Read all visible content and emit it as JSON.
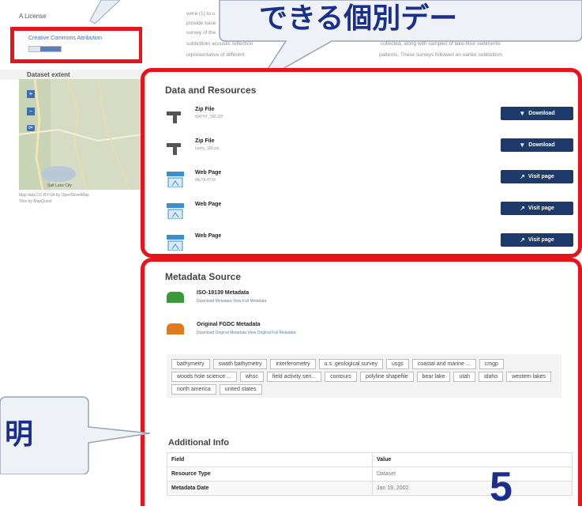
{
  "sidebar": {
    "license_heading": "A License",
    "license_link": "Creative Commons Attribution",
    "extent_heading": "Dataset extent",
    "map_credit_line1": "Map data CC-BY-SA by OpenStreetMap",
    "map_credit_line2": "Tiles by MapQuest",
    "map_label": "Salt Lake City",
    "shield_label": "84"
  },
  "description": {
    "line1": "were (1) to u",
    "line2": "provide base",
    "line3": "survey of the ",
    "line4a": "subbottom acoustic reflection",
    "line4b": "collected, along with samples of lake-floor sediments",
    "line5a": "representative of different",
    "line5b": "patterns. These surveys followed an earlier subbottom"
  },
  "callouts": {
    "top_text": "できる個別デー",
    "left_text": "明",
    "page_number": "5"
  },
  "resources": {
    "title": "Data and Resources",
    "items": [
      {
        "name": "Zip File",
        "sub": "BATHY_SM.ZIP",
        "button": "Download",
        "icon": "download-icon"
      },
      {
        "name": "Zip File",
        "sub": "bathy_SM.zip",
        "button": "Download",
        "icon": "download-icon"
      },
      {
        "name": "Web Page",
        "sub": "META.HTM",
        "button": "Visit page",
        "icon": "external-link-icon"
      },
      {
        "name": "Web Page",
        "sub": "",
        "button": "Visit page",
        "icon": "external-link-icon"
      },
      {
        "name": "Web Page",
        "sub": "",
        "button": "Visit page",
        "icon": "external-link-icon"
      }
    ]
  },
  "metadata": {
    "title": "Metadata Source",
    "items": [
      {
        "name": "ISO-19139 Metadata",
        "links": "Download Metadata   View Full Metadata",
        "color": "#3a9a3a"
      },
      {
        "name": "Original FGDC Metadata",
        "links": "Download Original Metadata   View Original Full Metadata",
        "color": "#e07a1e"
      }
    ]
  },
  "tags": [
    "bathymetry",
    "swath bathymetry",
    "interferometry",
    "u.s. geological survey",
    "usgs",
    "coastal and marine ...",
    "cmgp",
    "woods hole science ...",
    "whsc",
    "field activity seri...",
    "contours",
    "polyline shapefile",
    "bear lake",
    "utah",
    "idaho",
    "western lakes",
    "north america",
    "united states"
  ],
  "additional_info": {
    "title": "Additional Info",
    "header": [
      "Field",
      "Value"
    ],
    "rows": [
      [
        "Resource Type",
        "Dataset"
      ],
      [
        "Metadata Date",
        "Jan 19, 2002"
      ]
    ]
  },
  "colors": {
    "highlight_red": "#e8131b",
    "callout_text": "#1a2f8c",
    "button_navy": "#1d3a6b"
  }
}
